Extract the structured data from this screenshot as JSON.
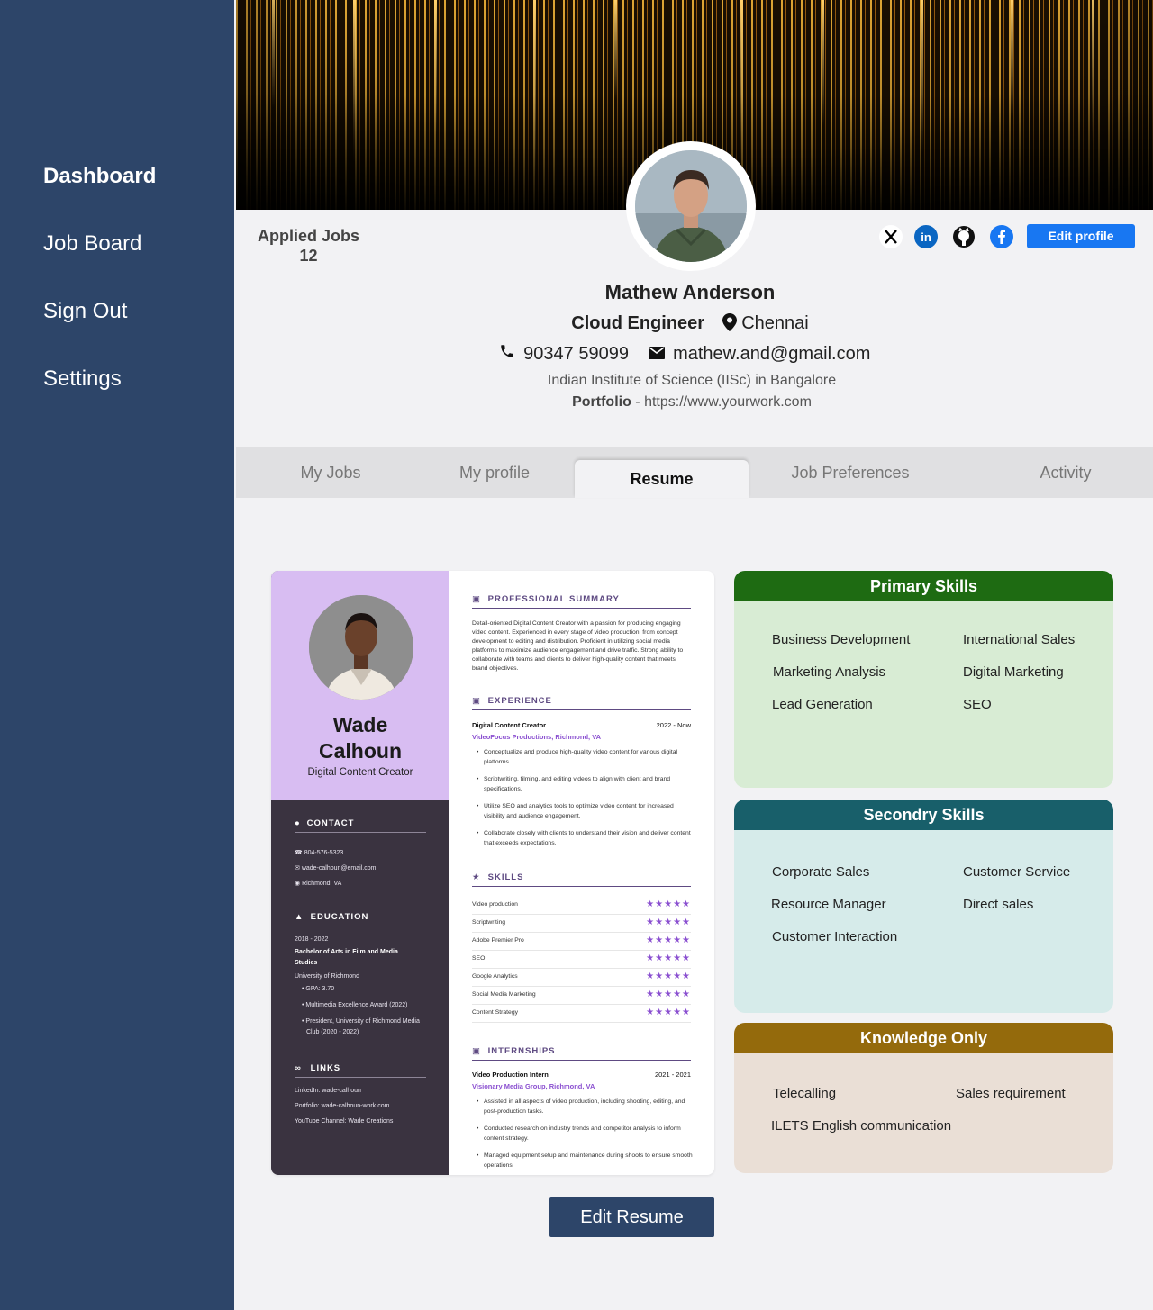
{
  "sidebar": {
    "items": [
      {
        "label": "Dashboard"
      },
      {
        "label": "Job Board"
      },
      {
        "label": "Sign Out"
      },
      {
        "label": "Settings"
      }
    ]
  },
  "applied_jobs": {
    "label": "Applied Jobs",
    "count": "12"
  },
  "profile": {
    "name": "Mathew Anderson",
    "role": "Cloud  Engineer",
    "location": "Chennai",
    "phone": "90347 59099",
    "email": "mathew.and@gmail.com",
    "institution": "Indian Institute of Science (IISc) in Bangalore",
    "portfolio_label": "Portfolio",
    "portfolio_sep": " - ",
    "portfolio_url": "https://www.yourwork.com"
  },
  "socials": [
    "x-icon",
    "linkedin-icon",
    "github-icon",
    "facebook-icon"
  ],
  "edit_profile_label": "Edit profile",
  "tabs": [
    {
      "label": "My Jobs"
    },
    {
      "label": "My profile"
    },
    {
      "label": "Resume"
    },
    {
      "label": "Job Preferences"
    },
    {
      "label": "Activity"
    }
  ],
  "resume": {
    "name_first": "Wade",
    "name_last": "Calhoun",
    "title": "Digital Content Creator",
    "contact_heading": "CONTACT",
    "contact": {
      "phone": "804-576-5323",
      "email": "wade-calhoun@email.com",
      "location": "Richmond, VA"
    },
    "education_heading": "EDUCATION",
    "education": {
      "years": "2018 - 2022",
      "degree_l1": "Bachelor of Arts in Film and Media",
      "degree_l2": "Studies",
      "school": "University of Richmond",
      "b1": "GPA: 3.70",
      "b2": "Multimedia Excellence Award (2022)",
      "b3_l1": "President, University of Richmond Media",
      "b3_l2": "Club (2020 - 2022)"
    },
    "links_heading": "LINKS",
    "links": {
      "linkedin": "LinkedIn: wade-calhoun",
      "portfolio": "Portfolio: wade-calhoun-work.com",
      "youtube": "YouTube Channel: Wade Creations"
    },
    "summary_heading": "PROFESSIONAL SUMMARY",
    "summary": "Detail-oriented Digital Content Creator with a passion for producing engaging video content. Experienced in every stage of video production, from concept development to editing and distribution. Proficient in utilizing social media platforms to maximize audience engagement and drive traffic. Strong ability to collaborate with teams and clients to deliver high-quality content that meets brand objectives.",
    "experience_heading": "EXPERIENCE",
    "experience": {
      "title": "Digital Content Creator",
      "dates": "2022 - Now",
      "company": "VideoFocus Productions, Richmond, VA",
      "bullets": [
        "Conceptualize and produce high-quality video content for various digital platforms.",
        "Scriptwriting, filming, and editing videos to align with client and brand specifications.",
        "Utilize SEO and analytics tools to optimize video content for increased visibility and audience engagement.",
        "Collaborate closely with clients to understand their vision and deliver content that exceeds expectations."
      ]
    },
    "skills_heading": "SKILLS",
    "skills": [
      {
        "name": "Video production",
        "stars": "★★★★★"
      },
      {
        "name": "Scriptwriting",
        "stars": "★★★★★"
      },
      {
        "name": "Adobe Premier Pro",
        "stars": "★★★★★"
      },
      {
        "name": "SEO",
        "stars": "★★★★★"
      },
      {
        "name": "Google Analytics",
        "stars": "★★★★★"
      },
      {
        "name": "Social Media Marketing",
        "stars": "★★★★★"
      },
      {
        "name": "Content Strategy",
        "stars": "★★★★★"
      }
    ],
    "internships_heading": "INTERNSHIPS",
    "internship": {
      "title": "Video Production Intern",
      "dates": "2021 - 2021",
      "company": "Visionary Media Group, Richmond, VA",
      "bullets": [
        "Assisted in all aspects of video production, including shooting, editing, and post-production tasks.",
        "Conducted research on industry trends and competitor analysis to inform content strategy.",
        "Managed equipment setup and maintenance during shoots to ensure smooth operations."
      ]
    }
  },
  "primary_skills": {
    "title": "Primary Skills",
    "color": "#1e6b12",
    "bg": "#d8ecd4",
    "items": [
      "Business  Development",
      "International Sales",
      "Marketing Analysis",
      "Digital Marketing",
      "Lead Generation",
      "SEO"
    ]
  },
  "secondary_skills": {
    "title": "Secondry Skills",
    "color": "#185f6a",
    "bg": "#d6ebea",
    "items": [
      "Corporate Sales",
      "Customer Service",
      "Resource Manager",
      "Direct sales",
      "Customer Interaction"
    ]
  },
  "knowledge_only": {
    "title": "Knowledge Only",
    "color": "#946a0c",
    "bg": "#eadfd6",
    "items": [
      "Telecalling",
      "Sales requirement",
      "ILETS English communication"
    ]
  },
  "edit_resume_label": "Edit Resume"
}
